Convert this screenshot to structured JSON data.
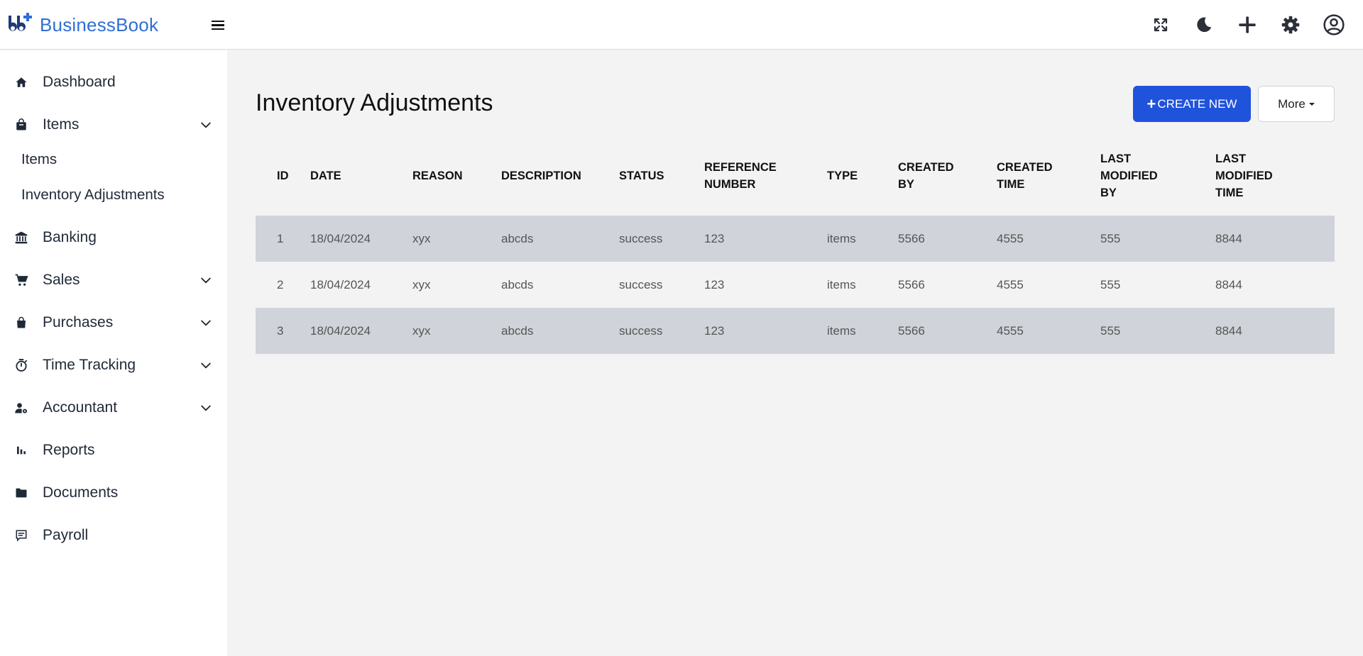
{
  "app": {
    "name": "BusinessBook",
    "logo_text": "bb+"
  },
  "header": {
    "icons": [
      "fullscreen-icon",
      "moon-icon",
      "plus-icon",
      "gear-icon",
      "account-icon"
    ]
  },
  "sidebar": {
    "items": [
      {
        "label": "Dashboard",
        "icon": "home-icon",
        "expandable": false
      },
      {
        "label": "Items",
        "icon": "bag-icon",
        "expandable": true,
        "expanded": true,
        "children": [
          {
            "label": "Items"
          },
          {
            "label": "Inventory Adjustments"
          }
        ]
      },
      {
        "label": "Banking",
        "icon": "bank-icon",
        "expandable": false
      },
      {
        "label": "Sales",
        "icon": "cart-icon",
        "expandable": true
      },
      {
        "label": "Purchases",
        "icon": "shopping-bag-icon",
        "expandable": true
      },
      {
        "label": "Time Tracking",
        "icon": "stopwatch-icon",
        "expandable": true
      },
      {
        "label": "Accountant",
        "icon": "user-gear-icon",
        "expandable": true
      },
      {
        "label": "Reports",
        "icon": "bar-chart-icon",
        "expandable": false
      },
      {
        "label": "Documents",
        "icon": "folder-icon",
        "expandable": false
      },
      {
        "label": "Payroll",
        "icon": "receipt-icon",
        "expandable": false
      }
    ]
  },
  "page": {
    "title": "Inventory Adjustments",
    "create_label": "CREATE NEW",
    "more_label": "More"
  },
  "table": {
    "columns": [
      [
        "ID"
      ],
      [
        "DATE"
      ],
      [
        "REASON"
      ],
      [
        "DESCRIPTION"
      ],
      [
        "STATUS"
      ],
      [
        "REFERENCE",
        "NUMBER"
      ],
      [
        "TYPE"
      ],
      [
        "CREATED",
        "BY"
      ],
      [
        "CREATED",
        "TIME"
      ],
      [
        "LAST",
        "MODIFIED",
        "BY"
      ],
      [
        "LAST",
        "MODIFIED",
        "TIME"
      ]
    ],
    "rows": [
      [
        "1",
        "18/04/2024",
        "xyx",
        "abcds",
        "success",
        "123",
        "items",
        "5566",
        "4555",
        "555",
        "8844"
      ],
      [
        "2",
        "18/04/2024",
        "xyx",
        "abcds",
        "success",
        "123",
        "items",
        "5566",
        "4555",
        "555",
        "8844"
      ],
      [
        "3",
        "18/04/2024",
        "xyx",
        "abcds",
        "success",
        "123",
        "items",
        "5566",
        "4555",
        "555",
        "8844"
      ]
    ]
  },
  "colors": {
    "brand": "#2f6fd6",
    "primary_button": "#2053dc",
    "row_striped": "#d1d3da",
    "page_bg": "#f3f3f4"
  }
}
